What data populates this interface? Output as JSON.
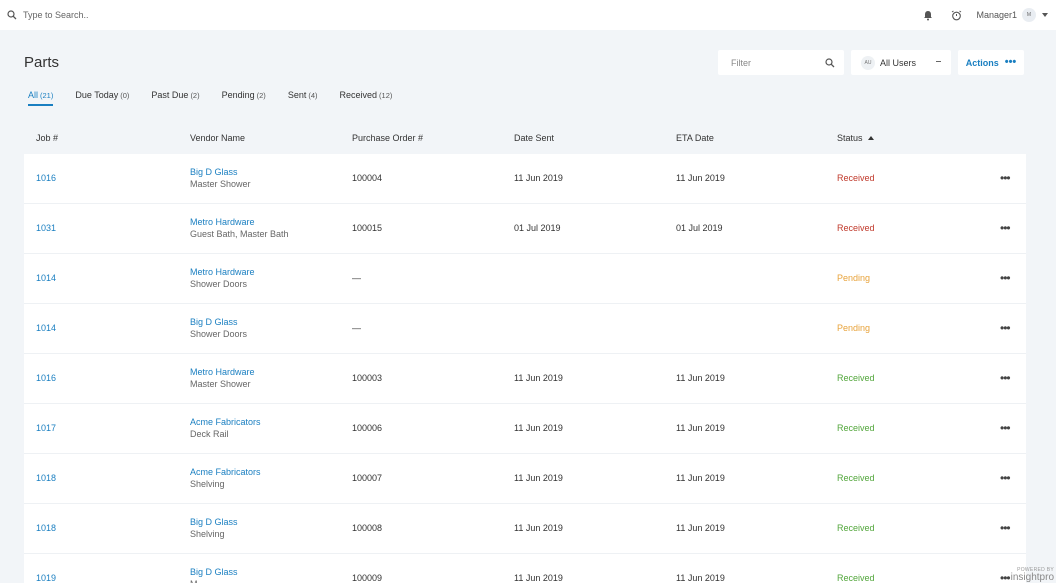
{
  "search": {
    "placeholder": "Type to Search.."
  },
  "user": {
    "name": "Manager1",
    "avatar": "M"
  },
  "page": {
    "title": "Parts"
  },
  "filter": {
    "placeholder": "Filter"
  },
  "users_select": {
    "badge": "AU",
    "label": "All Users"
  },
  "actions": {
    "label": "Actions"
  },
  "tabs": [
    {
      "label": "All",
      "count": "(21)",
      "active": true
    },
    {
      "label": "Due Today",
      "count": "(0)"
    },
    {
      "label": "Past Due",
      "count": "(2)"
    },
    {
      "label": "Pending",
      "count": "(2)"
    },
    {
      "label": "Sent",
      "count": "(4)"
    },
    {
      "label": "Received",
      "count": "(12)"
    }
  ],
  "table": {
    "headers": {
      "job": "Job #",
      "vendor": "Vendor Name",
      "po": "Purchase Order #",
      "sent": "Date Sent",
      "eta": "ETA Date",
      "status": "Status"
    },
    "rows": [
      {
        "job": "1016",
        "vendor": "Big D Glass",
        "sub": "Master Shower",
        "po": "100004",
        "sent": "11 Jun 2019",
        "eta": "11 Jun 2019",
        "status": "Received",
        "status_class": "st-received-red"
      },
      {
        "job": "1031",
        "vendor": "Metro Hardware",
        "sub": "Guest Bath, Master Bath",
        "po": "100015",
        "sent": "01 Jul 2019",
        "eta": "01 Jul 2019",
        "status": "Received",
        "status_class": "st-received-red"
      },
      {
        "job": "1014",
        "vendor": "Metro Hardware",
        "sub": "Shower Doors",
        "po": "—",
        "sent": "",
        "eta": "",
        "status": "Pending",
        "status_class": "st-pending"
      },
      {
        "job": "1014",
        "vendor": "Big D Glass",
        "sub": "Shower Doors",
        "po": "—",
        "sent": "",
        "eta": "",
        "status": "Pending",
        "status_class": "st-pending"
      },
      {
        "job": "1016",
        "vendor": "Metro Hardware",
        "sub": "Master Shower",
        "po": "100003",
        "sent": "11 Jun 2019",
        "eta": "11 Jun 2019",
        "status": "Received",
        "status_class": "st-received-green"
      },
      {
        "job": "1017",
        "vendor": "Acme Fabricators",
        "sub": "Deck Rail",
        "po": "100006",
        "sent": "11 Jun 2019",
        "eta": "11 Jun 2019",
        "status": "Received",
        "status_class": "st-received-green"
      },
      {
        "job": "1018",
        "vendor": "Acme Fabricators",
        "sub": "Shelving",
        "po": "100007",
        "sent": "11 Jun 2019",
        "eta": "11 Jun 2019",
        "status": "Received",
        "status_class": "st-received-green"
      },
      {
        "job": "1018",
        "vendor": "Big D Glass",
        "sub": "Shelving",
        "po": "100008",
        "sent": "11 Jun 2019",
        "eta": "11 Jun 2019",
        "status": "Received",
        "status_class": "st-received-green"
      },
      {
        "job": "1019",
        "vendor": "Big D Glass",
        "sub": "M",
        "po": "100009",
        "sent": "11 Jun 2019",
        "eta": "11 Jun 2019",
        "status": "Received",
        "status_class": "st-received-green"
      }
    ],
    "more": "•••"
  },
  "branding": {
    "powered": "POWERED BY",
    "name": "insightpro"
  },
  "colors": {
    "accent": "#1a7fc1",
    "received_red": "#c0392b",
    "pending": "#e8a33b",
    "received_green": "#52a63b"
  }
}
